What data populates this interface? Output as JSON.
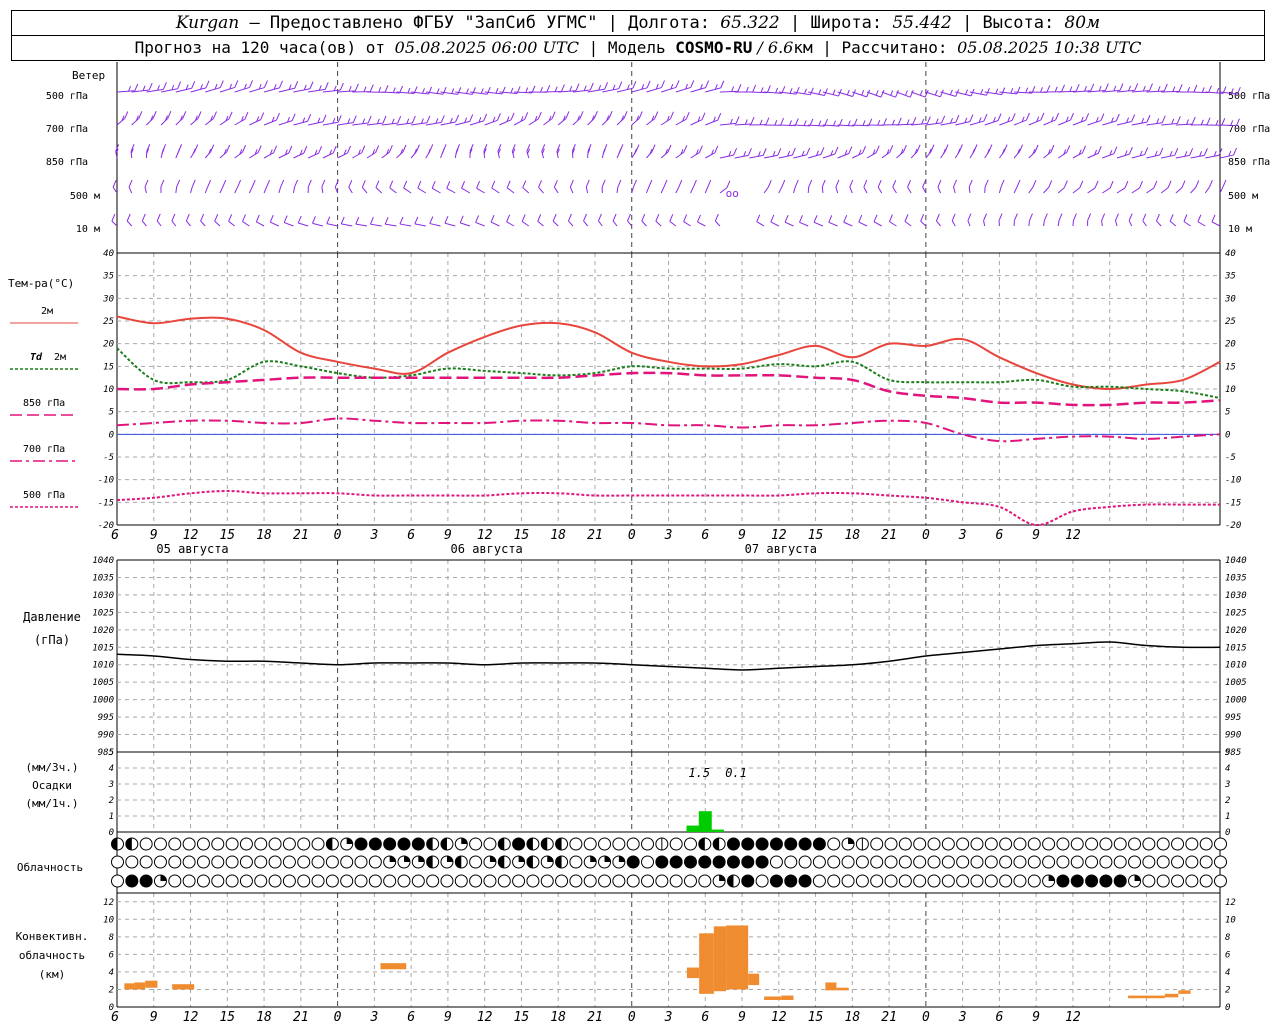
{
  "header": {
    "city": "Kurgan",
    "dash": " — ",
    "provider": "Предоставлено ФГБУ \"ЗапСиб УГМС\"",
    "lon_label": " | Долгота: ",
    "lon": "65.322",
    "lat_label": " | Широта: ",
    "lat": "55.442",
    "alt_label": " | Высота: ",
    "alt": "80м",
    "forecast_label": "Прогноз на 120 часа(ов) от ",
    "forecast_start": "05.08.2025 06:00 UTC",
    "model_label": " | Модель ",
    "model": "COSMO-RU",
    "resolution": " / 6.6",
    "res_unit": "км",
    "computed_label": " | Рассчитано: ",
    "computed": "05.08.2025 10:38 UTC"
  },
  "colors": {
    "wind": "#8a2be2",
    "t2m": "#e8453c",
    "td2m": "#1a7f1a",
    "t850": "#e0147c",
    "precip": "#00cc00",
    "conv": "#f08c30",
    "grid": "#a8a8a8",
    "pressure": "#000000"
  },
  "chart_data": [
    {
      "type": "barbs",
      "ylabel": "Ветер",
      "levels": [
        "500 гПа",
        "700 гПа",
        "850 гПа",
        "500 м",
        "10 м"
      ],
      "calm_marks": "oo"
    },
    {
      "type": "line",
      "ylabel": "Тем-ра(°C)",
      "ylim": [
        -20,
        40
      ],
      "yticks": [
        -20,
        -15,
        -10,
        -5,
        0,
        5,
        10,
        15,
        20,
        25,
        30,
        35,
        40
      ],
      "x_tick_labels": [
        "6",
        "9",
        "12",
        "15",
        "18",
        "21",
        "0",
        "3",
        "6",
        "9",
        "12",
        "15",
        "18",
        "21",
        "0",
        "3",
        "6",
        "9",
        "12",
        "15",
        "18",
        "21",
        "0",
        "3",
        "6",
        "9",
        "12"
      ],
      "date_labels": [
        "05 августа",
        "06 августа",
        "07 августа"
      ],
      "legend": [
        {
          "name": "2м",
          "key": "t2m"
        },
        {
          "name": "Td 2м",
          "key": "td2m"
        },
        {
          "name": "850 гПа",
          "key": "t850"
        },
        {
          "name": "700 гПа",
          "key": "t700"
        },
        {
          "name": "500 гПа",
          "key": "t500"
        }
      ],
      "series": [
        {
          "key": "t2m",
          "x": [
            0,
            3,
            6,
            9,
            12,
            15,
            18,
            21,
            24,
            27,
            30,
            33,
            36,
            39,
            42,
            45,
            48,
            51,
            54,
            57,
            60,
            63,
            66,
            69,
            72,
            75,
            78,
            81,
            84,
            87,
            90
          ],
          "values": [
            26,
            24.5,
            25.5,
            25.5,
            23,
            18,
            16,
            14.5,
            13.5,
            18,
            21.5,
            24,
            24.5,
            22.5,
            18,
            16,
            15,
            15.5,
            17.5,
            19.5,
            17,
            20,
            19.5,
            21,
            17,
            13.5,
            11,
            10,
            11,
            12,
            16
          ]
        },
        {
          "key": "td2m",
          "x": [
            0,
            3,
            6,
            9,
            12,
            15,
            18,
            21,
            24,
            27,
            30,
            33,
            36,
            39,
            42,
            45,
            48,
            51,
            54,
            57,
            60,
            63,
            66,
            69,
            72,
            75,
            78,
            81,
            84,
            87,
            90
          ],
          "values": [
            19,
            12,
            11.5,
            12,
            16,
            15,
            13.5,
            12.5,
            13,
            14.5,
            14,
            13.5,
            13,
            13.5,
            15,
            14.5,
            14.5,
            14.5,
            15.5,
            15,
            16,
            12,
            11.5,
            11.5,
            11.5,
            12,
            10.5,
            10.5,
            10,
            9.5,
            8
          ]
        },
        {
          "key": "t850",
          "x": [
            0,
            3,
            6,
            9,
            12,
            15,
            18,
            21,
            24,
            27,
            30,
            33,
            36,
            39,
            42,
            45,
            48,
            51,
            54,
            57,
            60,
            63,
            66,
            69,
            72,
            75,
            78,
            81,
            84,
            87,
            90
          ],
          "values": [
            10,
            10,
            11,
            11.5,
            12,
            12.5,
            12.5,
            12.5,
            12.5,
            12.5,
            12.5,
            12.5,
            12.5,
            13,
            13.5,
            13.5,
            13,
            13,
            13,
            12.5,
            12,
            9.5,
            8.5,
            8,
            7,
            7,
            6.5,
            6.5,
            7,
            7,
            7.5
          ]
        },
        {
          "key": "t700",
          "x": [
            0,
            3,
            6,
            9,
            12,
            15,
            18,
            21,
            24,
            27,
            30,
            33,
            36,
            39,
            42,
            45,
            48,
            51,
            54,
            57,
            60,
            63,
            66,
            69,
            72,
            75,
            78,
            81,
            84,
            87,
            90
          ],
          "values": [
            2,
            2.5,
            3,
            3,
            2.5,
            2.5,
            3.5,
            3,
            2.5,
            2.5,
            2.5,
            3,
            3,
            2.5,
            2.5,
            2,
            2,
            1.5,
            2,
            2,
            2.5,
            3,
            2.5,
            0,
            -1.5,
            -1,
            -0.5,
            -0.5,
            -1,
            -0.5,
            0
          ]
        },
        {
          "key": "t500",
          "x": [
            0,
            3,
            6,
            9,
            12,
            15,
            18,
            21,
            24,
            27,
            30,
            33,
            36,
            39,
            42,
            45,
            48,
            51,
            54,
            57,
            60,
            63,
            66,
            69,
            72,
            75,
            78,
            81,
            84,
            87,
            90
          ],
          "values": [
            -14.5,
            -14,
            -13,
            -12.5,
            -13,
            -13,
            -13,
            -13.5,
            -13.5,
            -13.5,
            -13.5,
            -13,
            -13,
            -13.5,
            -13.5,
            -13.5,
            -13.5,
            -13.5,
            -13.5,
            -13,
            -13,
            -13.5,
            -14,
            -15,
            -16,
            -20,
            -17,
            -16,
            -15.5,
            -15.5,
            -15.5
          ]
        }
      ]
    },
    {
      "type": "line",
      "ylabel": "Давление",
      "yunit": "(гПа)",
      "ylim": [
        985,
        1040
      ],
      "yticks": [
        985,
        990,
        995,
        1000,
        1005,
        1010,
        1015,
        1020,
        1025,
        1030,
        1035,
        1040
      ],
      "x": [
        0,
        3,
        6,
        9,
        12,
        15,
        18,
        21,
        24,
        27,
        30,
        33,
        36,
        39,
        42,
        45,
        48,
        51,
        54,
        57,
        60,
        63,
        66,
        69,
        72,
        75,
        78,
        81,
        84,
        87,
        90
      ],
      "values": [
        1013,
        1012.5,
        1011.5,
        1011,
        1011,
        1010.5,
        1010,
        1010.5,
        1010.5,
        1010.5,
        1010,
        1010.5,
        1010.5,
        1010.5,
        1010,
        1009.5,
        1009,
        1008.5,
        1009,
        1009.5,
        1010,
        1011,
        1012.5,
        1013.5,
        1014.5,
        1015.5,
        1016,
        1016.5,
        1015.5,
        1015,
        1015
      ]
    },
    {
      "type": "bar",
      "ylabel": "Осадки",
      "yunit3": "(мм/3ч.)",
      "yunit1": "(мм/1ч.)",
      "ylim": [
        0,
        5
      ],
      "yticks": [
        0,
        1,
        2,
        3,
        4,
        5
      ],
      "totals": [
        {
          "x": 48,
          "label": "1.5"
        },
        {
          "x": 51,
          "label": "0.1"
        }
      ],
      "bars": [
        {
          "x": 47,
          "value": 0.4
        },
        {
          "x": 48,
          "value": 1.3
        },
        {
          "x": 49,
          "value": 0.15
        }
      ]
    },
    {
      "type": "symbols",
      "ylabel": "Облачность",
      "rows": [
        "dhooooooooooooohqeeeeehhqoohehhhoooooovoohheeeeeeeoqvooooooooooooooooooooooooo",
        "oooooooooooooooooooqqqhqhoqhqhqhoqqqeoeeeeeeeeooooooooooooooooooooooooooooooooooooooo",
        "oeeqooooooooooooooooooooooooooooooooooooooqheoeeeooooooooooooooooqeeeeeqoooooooooooooooo"
      ]
    },
    {
      "type": "bar",
      "ylabel": "Конвективн. облачность",
      "yunit": "(км)",
      "ylim": [
        0,
        13
      ],
      "yticks": [
        0,
        2,
        4,
        6,
        8,
        10,
        12
      ],
      "bars": [
        {
          "x": 0.6,
          "x1": 1.4,
          "base": 2.0,
          "top": 2.7
        },
        {
          "x": 1.4,
          "x1": 2.3,
          "base": 2.0,
          "top": 2.8
        },
        {
          "x": 2.3,
          "x1": 3.3,
          "base": 2.2,
          "top": 3.0
        },
        {
          "x": 4.5,
          "x1": 6.3,
          "base": 2.0,
          "top": 2.6
        },
        {
          "x": 21.5,
          "x1": 23.6,
          "base": 4.3,
          "top": 5.0
        },
        {
          "x": 46.5,
          "x1": 47.5,
          "base": 3.3,
          "top": 4.5
        },
        {
          "x": 47.5,
          "x1": 48.7,
          "base": 1.5,
          "top": 8.4
        },
        {
          "x": 48.7,
          "x1": 49.7,
          "base": 1.8,
          "top": 9.2
        },
        {
          "x": 49.7,
          "x1": 51.5,
          "base": 2.0,
          "top": 9.3
        },
        {
          "x": 51.5,
          "x1": 52.4,
          "base": 2.5,
          "top": 3.8
        },
        {
          "x": 52.8,
          "x1": 54.2,
          "base": 0.8,
          "top": 1.2
        },
        {
          "x": 54.2,
          "x1": 55.2,
          "base": 0.8,
          "top": 1.3
        },
        {
          "x": 57.8,
          "x1": 58.7,
          "base": 1.9,
          "top": 2.8
        },
        {
          "x": 58.7,
          "x1": 59.7,
          "base": 1.9,
          "top": 2.2
        },
        {
          "x": 82.5,
          "x1": 85.5,
          "base": 1.0,
          "top": 1.3
        },
        {
          "x": 85.5,
          "x1": 86.6,
          "base": 1.1,
          "top": 1.5
        },
        {
          "x": 86.6,
          "x1": 87.6,
          "base": 1.5,
          "top": 1.9
        }
      ]
    }
  ]
}
